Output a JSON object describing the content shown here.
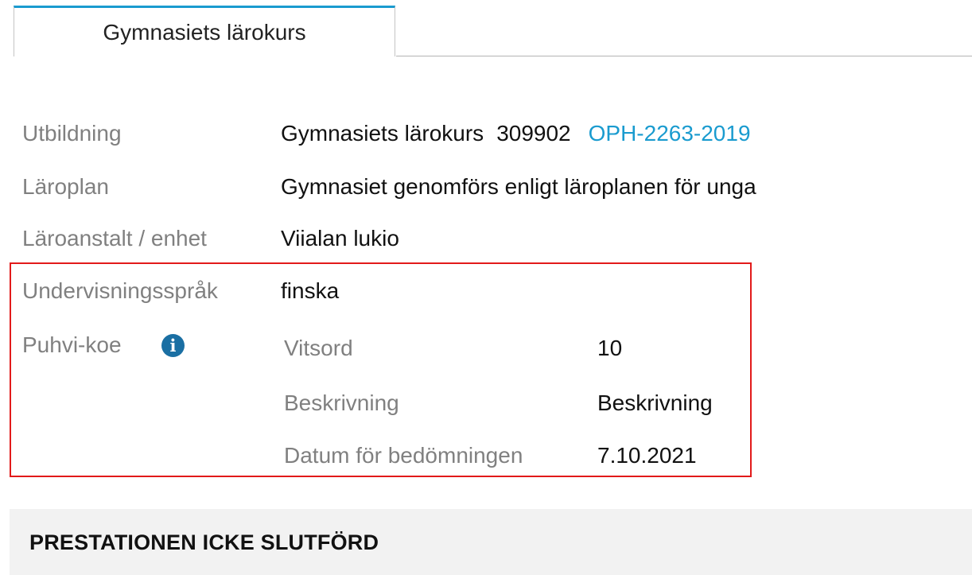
{
  "tabs": [
    {
      "label": "Gymnasiets lärokurs",
      "active": true
    }
  ],
  "details": {
    "utbildning": {
      "label": "Utbildning",
      "name": "Gymnasiets lärokurs",
      "code": "309902",
      "link": "OPH-2263-2019"
    },
    "laroplan": {
      "label": "Läroplan",
      "value": "Gymnasiet genomförs enligt läroplanen för unga"
    },
    "laroanstalt": {
      "label": "Läroanstalt / enhet",
      "value": "Viialan lukio"
    },
    "undervisningssprak": {
      "label": "Undervisningsspråk",
      "value": "finska"
    },
    "puhvi": {
      "label": "Puhvi-koe",
      "info_icon": "info-icon",
      "fields": [
        {
          "label": "Vitsord",
          "value": "10"
        },
        {
          "label": "Beskrivning",
          "value": "Beskrivning"
        },
        {
          "label": "Datum för bedömningen",
          "value": "7.10.2021"
        }
      ]
    }
  },
  "status": {
    "text": "PRESTATIONEN ICKE SLUTFÖRD"
  },
  "colors": {
    "accent": "#1a9bcf",
    "highlight_border": "#e21a1a",
    "label": "#808080",
    "status_bg": "#f2f2f2"
  }
}
